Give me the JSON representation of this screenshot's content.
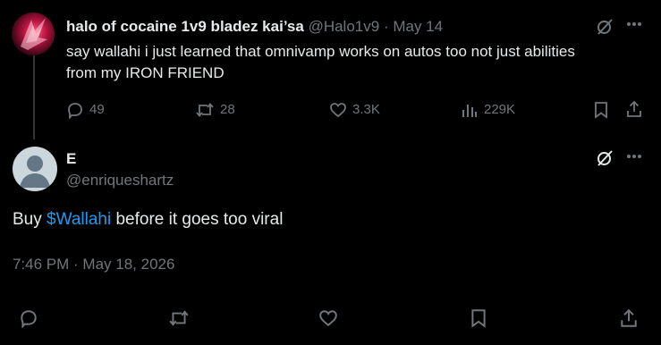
{
  "top_tweet": {
    "display_name": "halo of cocaine 1v9 bladez kai’sa",
    "handle": "@Halo1v9",
    "separator": "·",
    "date": "May 14",
    "text": "say wallahi i just learned that omnivamp works on autos too not just abilities from my IRON FRIEND",
    "replies": "49",
    "retweets": "28",
    "likes": "3.3K",
    "views": "229K"
  },
  "reply_tweet": {
    "display_name": "E",
    "handle": "@enriqueshartz",
    "text_before": "Buy ",
    "cashtag": "$Wallahi",
    "text_after": " before it goes too viral",
    "timestamp": "7:46 PM · May 18, 2026"
  },
  "colors": {
    "background": "#000000",
    "text": "#e7e9ea",
    "muted": "#71767b",
    "link": "#1d9bf0"
  },
  "icons": [
    "grok-icon",
    "more-icon",
    "reply-icon",
    "retweet-icon",
    "like-icon",
    "views-icon",
    "bookmark-icon",
    "share-icon"
  ]
}
